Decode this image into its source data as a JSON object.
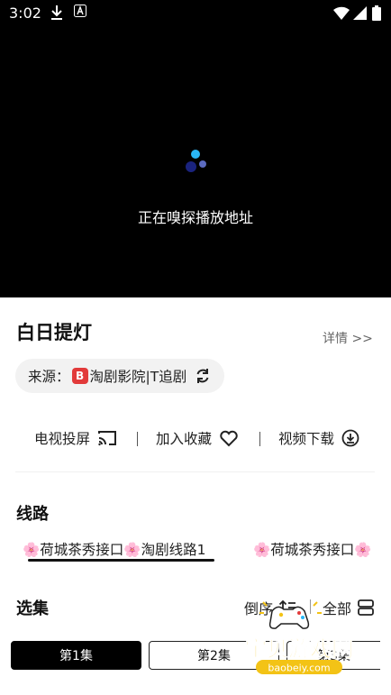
{
  "status_bar": {
    "time": "3:02"
  },
  "player": {
    "status_text": "正在嗅探播放地址"
  },
  "show": {
    "title": "白日提灯",
    "details_link": "详情 >>"
  },
  "source": {
    "label": "来源：",
    "logo_text": "B",
    "name": "淘剧影院|T追剧"
  },
  "actions": {
    "cast_label": "电视投屏",
    "favorite_label": "加入收藏",
    "download_label": "视频下载"
  },
  "routes": {
    "heading": "线路",
    "items": [
      "🌸荷城茶秀接口🌸淘剧线路1",
      "🌸荷城茶秀接口🌸"
    ]
  },
  "episodes": {
    "heading": "选集",
    "sort_label": "倒序",
    "all_label": "全部",
    "items": [
      "第1集",
      "第2集",
      "第3集"
    ]
  },
  "watermark": {
    "brand": "宝贝游戏网",
    "domain": "baobeiy.com"
  },
  "colors": {
    "accent": "#000000",
    "watermark_yellow": "#f3c316",
    "logo_red": "#e23a3a"
  }
}
